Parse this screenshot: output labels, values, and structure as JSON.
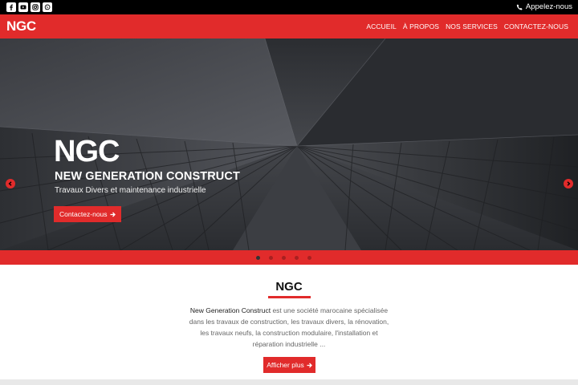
{
  "topbar": {
    "social_icons": [
      "facebook-icon",
      "youtube-icon",
      "instagram-icon",
      "whatsapp-icon"
    ],
    "call_label": "Appelez-nous"
  },
  "navbar": {
    "brand": "NGC",
    "menu": [
      "ACCUEIL",
      "À PROPOS",
      "NOS SERVICES",
      "CONTACTEZ-NOUS"
    ]
  },
  "hero": {
    "logo": "NGC",
    "title": "NEW GENERATION CONSTRUCT",
    "subtitle": "Travaux Divers et maintenance industrielle",
    "button": "Contactez-nous",
    "slide_count": 5,
    "active_slide": 1
  },
  "about": {
    "title": "NGC",
    "company": "New Generation Construct",
    "text_lines": [
      " est une société marocaine spécialisée",
      "dans les travaux de construction, les travaux divers, la rénovation,",
      "les travaux neufs, la construction modulaire, l'installation et",
      "réparation industrielle ..."
    ],
    "button": "Afficher plus"
  },
  "colors": {
    "brand_red": "#e12b2b",
    "topbar": "#000000"
  }
}
